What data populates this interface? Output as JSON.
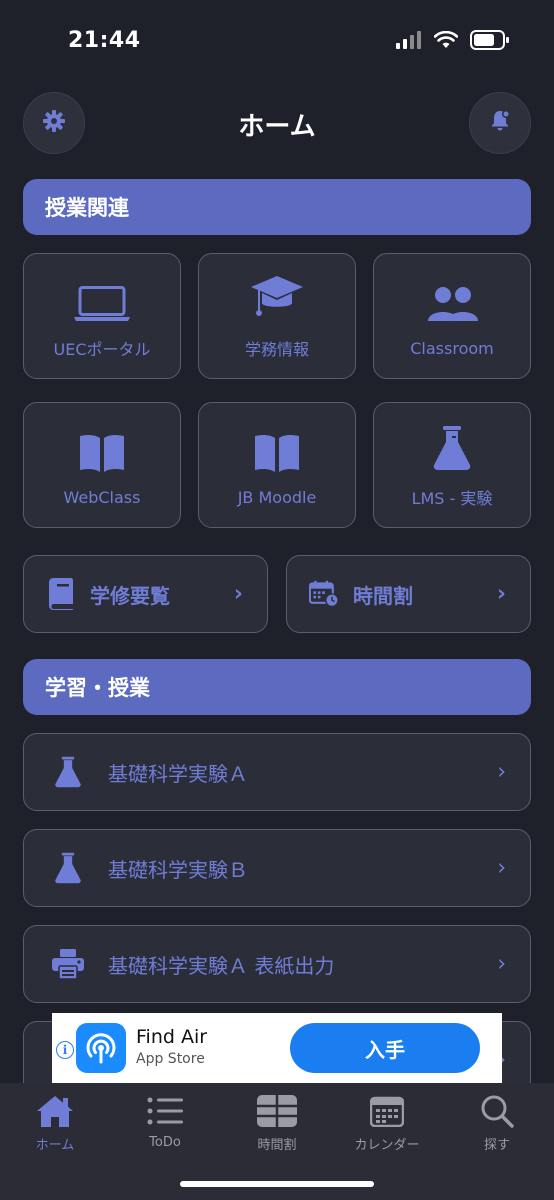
{
  "status_bar": {
    "time": "21:44"
  },
  "header": {
    "title": "ホーム",
    "settings_icon": "gear-icon",
    "notification_icon": "bell-icon"
  },
  "section_class": {
    "title": "授業関連",
    "tiles": [
      {
        "label": "UECポータル",
        "icon": "laptop-icon"
      },
      {
        "label": "学務情報",
        "icon": "graduation-cap-icon"
      },
      {
        "label": "Classroom",
        "icon": "users-icon"
      },
      {
        "label": "WebClass",
        "icon": "book-open-icon"
      },
      {
        "label": "JB Moodle",
        "icon": "book-open-icon"
      },
      {
        "label": "LMS - 実験",
        "icon": "flask-icon"
      }
    ],
    "wide_buttons": [
      {
        "label": "学修要覧",
        "icon": "book-icon"
      },
      {
        "label": "時間割",
        "icon": "calendar-clock-icon"
      }
    ]
  },
  "section_study": {
    "title": "学習・授業",
    "rows": [
      {
        "label": "基礎科学実験Ａ",
        "icon": "flask-icon"
      },
      {
        "label": "基礎科学実験Ｂ",
        "icon": "flask-icon"
      },
      {
        "label": "基礎科学実験Ａ 表紙出力",
        "icon": "printer-icon"
      }
    ]
  },
  "ad": {
    "app_name": "Find Air",
    "store": "App Store",
    "get_label": "入手"
  },
  "tab_bar": {
    "tabs": [
      {
        "label": "ホーム",
        "icon": "home-icon",
        "active": true
      },
      {
        "label": "ToDo",
        "icon": "list-icon",
        "active": false
      },
      {
        "label": "時間割",
        "icon": "grid-icon",
        "active": false
      },
      {
        "label": "カレンダー",
        "icon": "calendar-icon",
        "active": false
      },
      {
        "label": "探す",
        "icon": "search-icon",
        "active": false
      }
    ]
  },
  "colors": {
    "accent": "#5c6bc0",
    "icon_accent": "#6f7dd6",
    "background": "#1f212a",
    "card": "#2b2d38"
  }
}
